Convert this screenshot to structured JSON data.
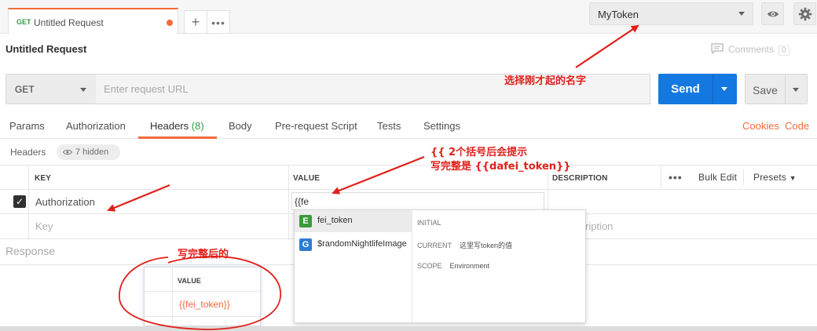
{
  "tab": {
    "method": "GET",
    "title": "Untitled Request"
  },
  "environment": {
    "selected": "MyToken"
  },
  "request": {
    "title": "Untitled Request",
    "comments_label": "Comments",
    "comments_count": "0",
    "method": "GET",
    "url_placeholder": "Enter request URL",
    "send_label": "Send",
    "save_label": "Save"
  },
  "request_tabs": {
    "params": "Params",
    "authorization": "Authorization",
    "headers": "Headers",
    "headers_count": "(8)",
    "body": "Body",
    "prerequest": "Pre-request Script",
    "tests": "Tests",
    "settings": "Settings",
    "cookies": "Cookies",
    "code": "Code"
  },
  "headers_section": {
    "label": "Headers",
    "hidden": "7 hidden",
    "columns": {
      "key": "KEY",
      "value": "VALUE",
      "description": "DESCRIPTION"
    },
    "bulk_edit": "Bulk Edit",
    "presets": "Presets",
    "row1": {
      "key": "Authorization",
      "value": "{{fe"
    },
    "row2": {
      "key_placeholder": "Key",
      "description_placeholder": "ription"
    }
  },
  "response_label": "Response",
  "autocomplete": {
    "items": [
      {
        "icon": "E",
        "name": "fei_token",
        "color": "#3a9a3a"
      },
      {
        "icon": "G",
        "name": "$randomNightlifeImage",
        "color": "#2d7dd2"
      }
    ],
    "initial_label": "INITIAL",
    "current_label": "CURRENT",
    "current_value": "这里写token的值",
    "scope_label": "SCOPE",
    "scope_value": "Environment"
  },
  "inset": {
    "header": "VALUE",
    "value": "{{fei_token}}"
  },
  "annotations": {
    "select_name": "选择刚才起的名字",
    "hint_line1": "{{  2个括号后会提示",
    "hint_line2": "写完整是 {{dafei_token}}",
    "after_complete": "写完整后的"
  },
  "colors": {
    "accent": "#f26b3a",
    "send": "#1379e0",
    "annotation": "#e0201b"
  }
}
